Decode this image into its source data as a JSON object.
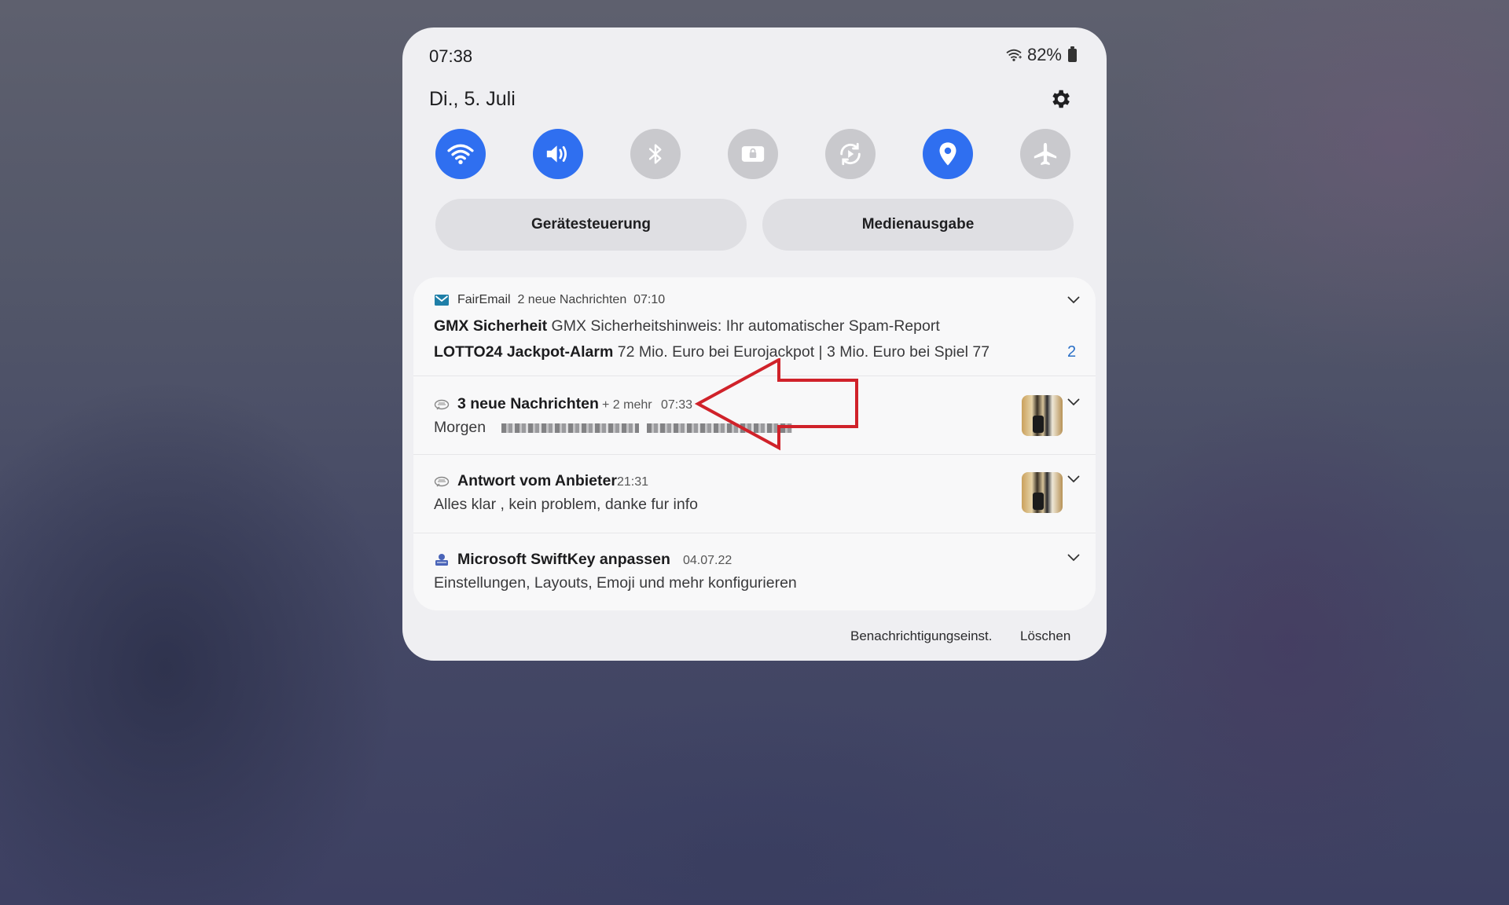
{
  "status": {
    "time": "07:38",
    "battery": "82%"
  },
  "date": "Di., 5. Juli",
  "quick_toggles": [
    {
      "name": "wifi",
      "state": "on"
    },
    {
      "name": "sound",
      "state": "on"
    },
    {
      "name": "bluetooth",
      "state": "off"
    },
    {
      "name": "lock-screen-rotation",
      "state": "off"
    },
    {
      "name": "auto-rotate",
      "state": "off"
    },
    {
      "name": "location",
      "state": "on"
    },
    {
      "name": "airplane-mode",
      "state": "off"
    }
  ],
  "buttons": {
    "device_control": "Gerätesteuerung",
    "media_output": "Medienausgabe"
  },
  "notifications": {
    "fairemail": {
      "app": "FairEmail",
      "summary": "2 neue Nachrichten",
      "time": "07:10",
      "line1_sender": "GMX Sicherheit",
      "line1_text": "GMX Sicherheitshinweis: Ihr automatischer Spam-Report",
      "line2_sender": "LOTTO24 Jackpot-Alarm",
      "line2_text": "72 Mio. Euro bei Eurojackpot | 3 Mio. Euro bei Spiel 77",
      "count": "2"
    },
    "chat1": {
      "title": "3 neue Nachrichten",
      "more": "+ 2 mehr",
      "time": "07:33",
      "text": "Morgen"
    },
    "chat2": {
      "title": "Antwort vom Anbieter",
      "time": "21:31",
      "text": "Alles klar , kein problem, danke fur info"
    },
    "swiftkey": {
      "title": "Microsoft SwiftKey anpassen",
      "time": "04.07.22",
      "text": "Einstellungen, Layouts, Emoji und mehr konfigurieren"
    }
  },
  "footer": {
    "settings": "Benachrichtigungseinst.",
    "clear": "Löschen"
  },
  "colors": {
    "toggle_on": "#2f6ff0",
    "toggle_off": "#c9c9cd",
    "annotation_arrow": "#d0222a",
    "count": "#2a6fc6"
  }
}
